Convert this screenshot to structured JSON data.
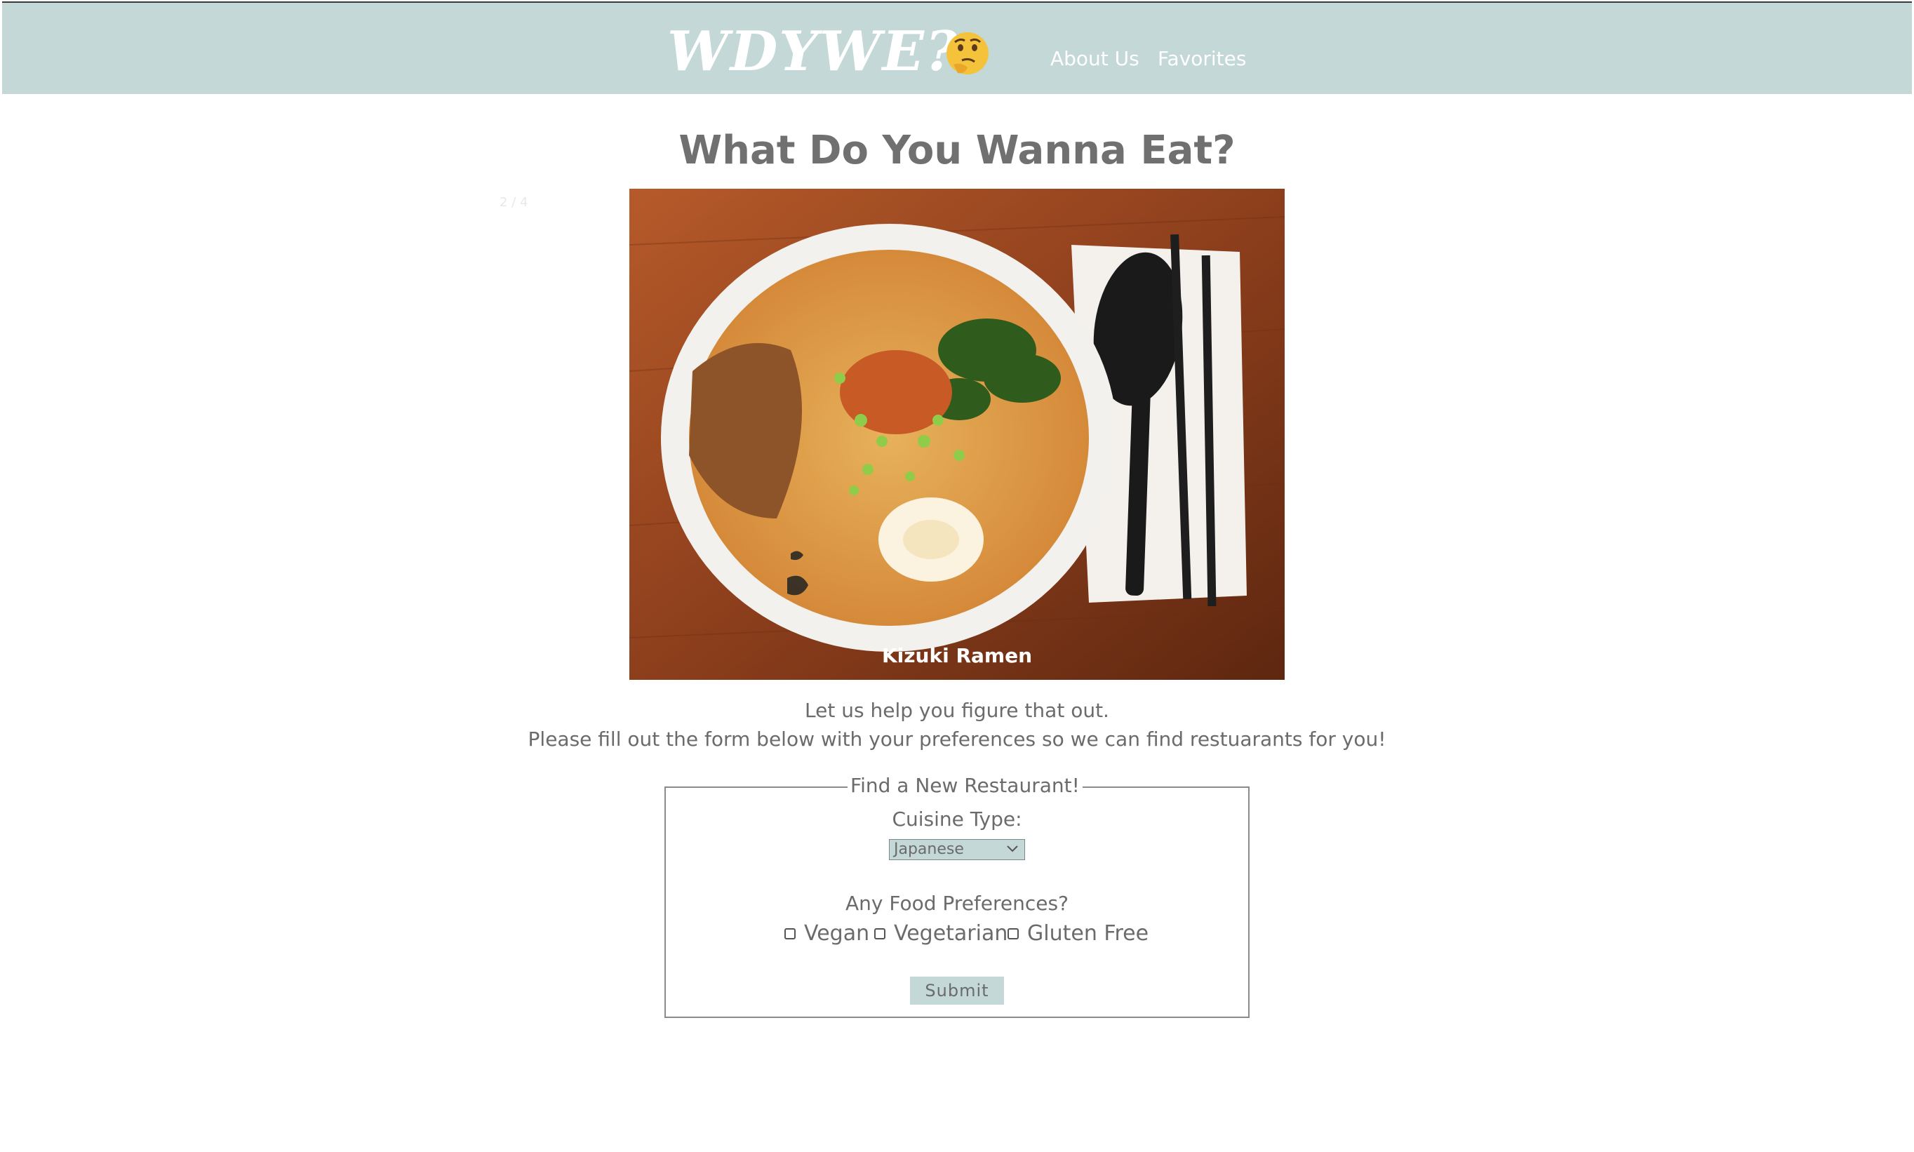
{
  "header": {
    "logo_text": "WDYWE?",
    "emoji": "thinking-face-icon",
    "nav": [
      {
        "label": "About Us"
      },
      {
        "label": "Favorites"
      }
    ],
    "bg_color": "#c3d8d7"
  },
  "main": {
    "title": "What Do You Wanna Eat?",
    "slideshow": {
      "counter": "2 / 4",
      "caption": "Kizuki Ramen"
    },
    "intro_line1": "Let us help you figure that out.",
    "intro_line2": "Please fill out the form below with your preferences so we can find restuarants for you!"
  },
  "form": {
    "legend": "Find a New Restaurant!",
    "cuisine_label": "Cuisine Type:",
    "cuisine_selected": "Japanese",
    "prefs_label": "Any Food Preferences?",
    "options": [
      {
        "label": "Vegan",
        "checked": false
      },
      {
        "label": "Vegetarian",
        "checked": false
      },
      {
        "label": "Gluten Free",
        "checked": false
      }
    ],
    "submit_label": "Submit"
  }
}
